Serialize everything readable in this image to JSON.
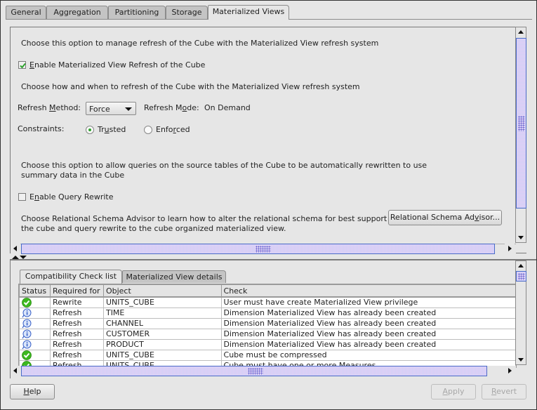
{
  "tabs": [
    {
      "label": "General",
      "active": false
    },
    {
      "label": "Aggregation",
      "active": false
    },
    {
      "label": "Partitioning",
      "active": false
    },
    {
      "label": "Storage",
      "active": false
    },
    {
      "label": "Materialized Views",
      "active": true
    }
  ],
  "mv_refresh": {
    "intro_text": "Choose this option to manage refresh of the Cube with the Materialized View refresh system",
    "enable_checkbox": {
      "mnemonic": "E",
      "label_rest": "nable Materialized View Refresh of the Cube",
      "checked": true
    },
    "how_text": "Choose how and when to refresh of the Cube with the Materialized View refresh system",
    "refresh_method_label": {
      "pre": "Refresh ",
      "mnemonic": "M",
      "post": "ethod:"
    },
    "refresh_method_value": "Force",
    "refresh_mode_label": {
      "pre": "Refresh M",
      "mnemonic": "o",
      "post": "de:"
    },
    "refresh_mode_value": "On Demand",
    "constraints_label": "Constraints:",
    "constraints_options": [
      {
        "pre": "Tr",
        "mnemonic": "u",
        "post": "sted",
        "selected": true
      },
      {
        "pre": "Enfo",
        "mnemonic": "r",
        "post": "ced",
        "selected": false
      }
    ]
  },
  "query_rewrite": {
    "intro_line1": "Choose this option to allow queries on the source tables of the Cube to be automatically rewritten to use",
    "intro_line2": "summary data in the Cube",
    "enable_checkbox": {
      "pre": "E",
      "mnemonic": "n",
      "post": "able Query Rewrite",
      "checked": false
    }
  },
  "advisor": {
    "line1": "Choose Relational Schema Advisor to learn how to alter the relational schema for best support o",
    "line2": "the cube and query rewrite to the cube organized materialized view.",
    "button": {
      "pre": "Relational Schema Ad",
      "mnemonic": "v",
      "post": "isor..."
    }
  },
  "sub_tabs": [
    {
      "label": "Compatibility Check list",
      "active": true
    },
    {
      "label": "Materialized View details",
      "active": false
    }
  ],
  "check_table": {
    "columns": [
      "Status",
      "Required for",
      "Object",
      "Check"
    ],
    "rows": [
      {
        "status": "ok-icon",
        "required_for": "Rewrite",
        "object": "UNITS_CUBE",
        "check": "User must have create Materialized View privilege"
      },
      {
        "status": "info-icon",
        "required_for": "Refresh",
        "object": "TIME",
        "check": "Dimension Materialized View has already been created"
      },
      {
        "status": "info-icon",
        "required_for": "Refresh",
        "object": "CHANNEL",
        "check": "Dimension Materialized View has already been created"
      },
      {
        "status": "info-icon",
        "required_for": "Refresh",
        "object": "CUSTOMER",
        "check": "Dimension Materialized View has already been created"
      },
      {
        "status": "info-icon",
        "required_for": "Refresh",
        "object": "PRODUCT",
        "check": "Dimension Materialized View has already been created"
      },
      {
        "status": "ok-icon",
        "required_for": "Refresh",
        "object": "UNITS_CUBE",
        "check": "Cube must be compressed"
      },
      {
        "status": "ok-icon",
        "required_for": "Refresh",
        "object": "UNITS_CUBE",
        "check": "Cube must have one or more Measures"
      }
    ]
  },
  "footer": {
    "help": {
      "mnemonic": "H",
      "post": "elp"
    },
    "apply": {
      "mnemonic": "A",
      "post": "pply",
      "enabled": false
    },
    "revert": {
      "mnemonic": "R",
      "post": "evert",
      "enabled": false
    }
  },
  "colors": {
    "ok_green": "#3cb81e",
    "info_blue": "#3a62c8",
    "scroll_thumb": "#cfd2f7",
    "scroll_border": "#4b6bc8"
  }
}
